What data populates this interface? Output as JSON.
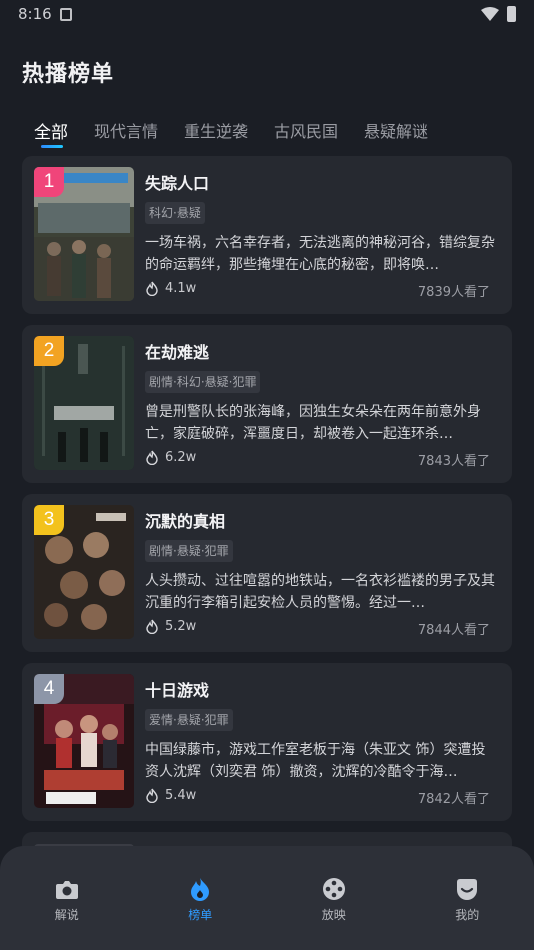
{
  "status_bar": {
    "time": "8:16"
  },
  "page_title": "热播榜单",
  "tabs": [
    {
      "label": "全部"
    },
    {
      "label": "现代言情"
    },
    {
      "label": "重生逆袭"
    },
    {
      "label": "古风民国"
    },
    {
      "label": "悬疑解谜"
    }
  ],
  "active_tab": "全部",
  "items": [
    {
      "rank": "1",
      "rank_color": "#f0457a",
      "title": "失踪人口",
      "tags": "科幻·悬疑",
      "description": "一场车祸，六名幸存者，无法逃离的神秘河谷，错综复杂的命运羁绊，那些掩埋在心底的秘密，即将唤…",
      "heat": "4.1w",
      "views": "7839人看了"
    },
    {
      "rank": "2",
      "rank_color": "#f2a322",
      "title": "在劫难逃",
      "tags": "剧情·科幻·悬疑·犯罪",
      "description": "曾是刑警队长的张海峰，因独生女朵朵在两年前意外身亡，家庭破碎，浑噩度日，却被卷入一起连环杀…",
      "heat": "6.2w",
      "views": "7843人看了"
    },
    {
      "rank": "3",
      "rank_color": "#f3c21d",
      "title": "沉默的真相",
      "tags": "剧情·悬疑·犯罪",
      "description": "人头攒动、过往喧嚣的地铁站，一名衣衫褴褛的男子及其沉重的行李箱引起安检人员的警惕。经过一…",
      "heat": "5.2w",
      "views": "7844人看了"
    },
    {
      "rank": "4",
      "rank_color": "#8d96a8",
      "title": "十日游戏",
      "tags": "爱情·悬疑·犯罪",
      "description": "中国绿藤市，游戏工作室老板于海（朱亚文 饰）突遭投资人沈辉（刘奕君 饰）撤资，沈辉的冷酷令于海…",
      "heat": "5.4w",
      "views": "7842人看了"
    }
  ],
  "bottom_nav": [
    {
      "label": "解说",
      "icon": "camera-icon"
    },
    {
      "label": "榜单",
      "icon": "flame-drop-icon"
    },
    {
      "label": "放映",
      "icon": "film-reel-icon"
    },
    {
      "label": "我的",
      "icon": "smile-icon"
    }
  ],
  "colors": {
    "accent": "#2f9bff",
    "background": "#1b1e25",
    "card": "#262930"
  }
}
